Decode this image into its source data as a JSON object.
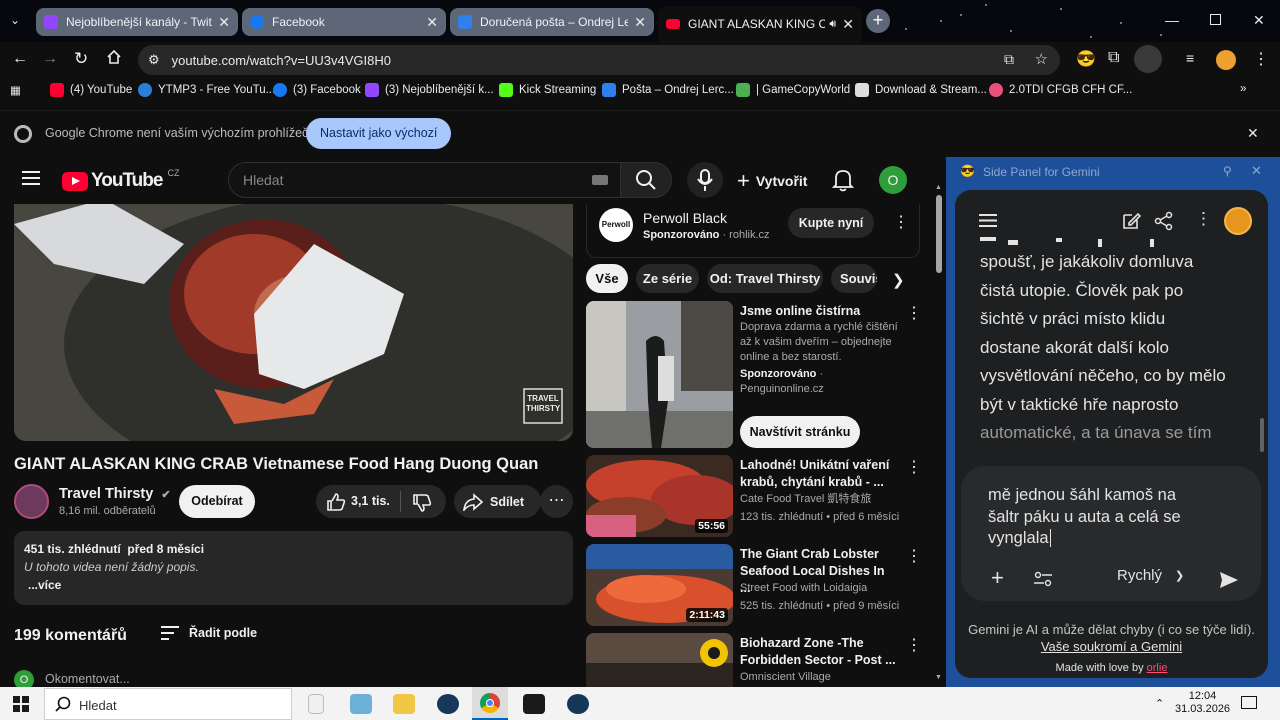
{
  "browser": {
    "tabs": [
      {
        "title": "Nejoblíbenější kanály - Twitch",
        "color": "#9146ff"
      },
      {
        "title": "Facebook",
        "color": "#1877f2"
      },
      {
        "title": "Doručená pošta – Ondrej Lerch",
        "color": "#2f80ed"
      },
      {
        "title": "GIANT ALASKAN KING CRA",
        "color": "#ff0033",
        "active": true
      }
    ],
    "url": "youtube.com/watch?v=UU3v4VGI8H0",
    "bookmarks": [
      {
        "label": "(4) YouTube",
        "color": "#ff0033"
      },
      {
        "label": "YTMP3 - Free YouTu...",
        "color": "#2b7fd8"
      },
      {
        "label": "(3) Facebook",
        "color": "#1877f2"
      },
      {
        "label": "(3) Nejoblíbenější k...",
        "color": "#9146ff"
      },
      {
        "label": "Kick Streaming",
        "color": "#53fc18"
      },
      {
        "label": "Pošta – Ondrej Lerc...",
        "color": "#2f80ed"
      },
      {
        "label": "| GameCopyWorld",
        "color": "#4caf50"
      },
      {
        "label": "Download & Stream...",
        "color": "#dddddd"
      },
      {
        "label": "2.0TDI CFGB CFH CF...",
        "color": "#ec4f7a"
      }
    ],
    "infobar": {
      "message": "Google Chrome není vaším výchozím prohlížečem",
      "button": "Nastavit jako výchozí"
    }
  },
  "youtube": {
    "logo_text": "YouTube",
    "country": "CZ",
    "search_placeholder": "Hledat",
    "create_label": "Vytvořit",
    "avatar_letter": "O",
    "video": {
      "watermark": "TRAVEL THIRSTY",
      "title": "GIANT ALASKAN KING CRAB Vietnamese Food Hang Duong Quan",
      "channel": "Travel Thirsty",
      "subscribers": "8,16 mil. odběratelů",
      "subscribe": "Odebírat",
      "likes": "3,1 tis.",
      "share": "Sdílet",
      "views": "451 tis. zhlédnutí",
      "age": "před 8 měsíci",
      "description": "U tohoto videa není žádný popis.",
      "more": "...více",
      "comments_count": "199 komentářů",
      "sort": "Řadit podle",
      "comment_placeholder": "Okomentovat..."
    },
    "ad_top": {
      "brand_logo": "Perwoll",
      "title": "Perwoll Black",
      "sponsored": "Sponzorováno",
      "domain": "rohlik.cz",
      "cta": "Kupte nyní"
    },
    "chips": [
      "Vše",
      "Ze série",
      "Od: Travel Thirsty",
      "Souvis"
    ],
    "ad_card": {
      "title": "Jsme online čistírna",
      "description": "Doprava zdarma a rychlé čištění až k vašim dveřím – objednejte online a bez starostí.",
      "sponsored": "Sponzorováno",
      "domain": "Penguinonline.cz",
      "cta": "Navštívit stránku"
    },
    "related": [
      {
        "title": "Lahodné! Unikátní vaření krabů, chytání krabů - ...",
        "channel": "Cate Food Travel 凱特食旅",
        "views": "123 tis. zhlédnutí",
        "age": "před 6 měsíci",
        "duration": "55:56"
      },
      {
        "title": "The Giant Crab Lobster Seafood Local Dishes In ...",
        "channel": "Street Food with Loidaigia",
        "views": "525 tis. zhlédnutí",
        "age": "před 9 měsíci",
        "duration": "2:11:43"
      },
      {
        "title": "Biohazard Zone -The Forbidden Sector - Post ...",
        "channel": "Omniscient Village",
        "views": "",
        "age": "",
        "duration": ""
      }
    ]
  },
  "gemini": {
    "panel_title": "Side Panel for Gemini",
    "chat_lines": [
      "spoušť, je jakákoliv domluva",
      "čistá utopie. Člověk pak po",
      "šichtě v práci místo klidu",
      "dostane akorát další kolo",
      "vysvětlování něčeho, co by mělo",
      "být v taktické hře naprosto",
      "automatické, a ta únava se tím"
    ],
    "input_text": "mě jednou šáhl kamoš na šaltr páku u auta a celá se vynglala",
    "mode": "Rychlý",
    "disclaimer": "Gemini je AI a může dělat chyby (i co se týče lidí).",
    "privacy_link": "Vaše soukromí a Gemini",
    "made_with": "Made with love by",
    "made_by": "orlie"
  },
  "taskbar": {
    "search": "Hledat",
    "time": "12:04",
    "date": "31.03.2026"
  },
  "colors": {
    "yt_red": "#ff0033",
    "gemini_frame": "#1d4f9a",
    "accent_button": "#a8c7fa"
  }
}
